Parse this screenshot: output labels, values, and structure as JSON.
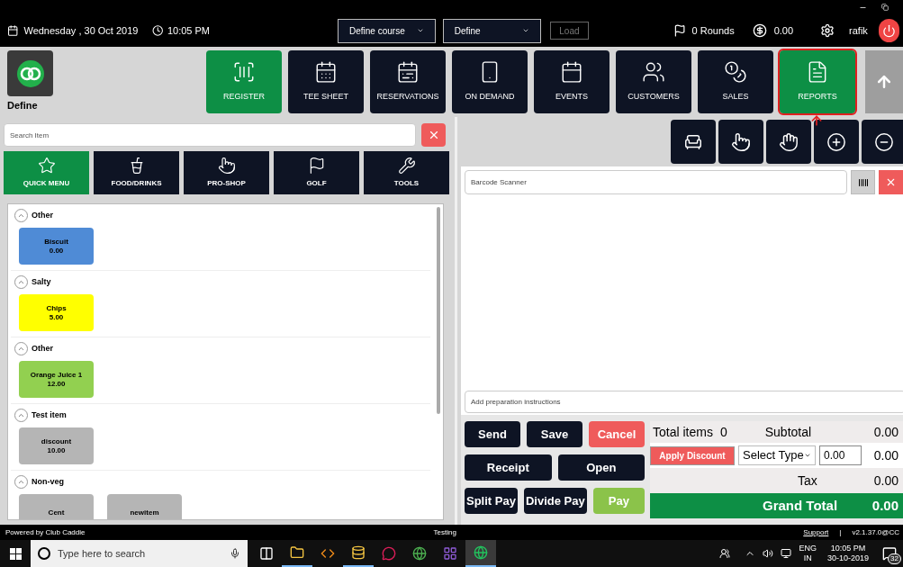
{
  "header": {
    "date": "Wednesday , 30 Oct 2019",
    "time": "10:05 PM",
    "course_select": "Define course",
    "define_select": "Define",
    "load_button": {
      "label": "Load",
      "disabled": true
    },
    "rounds": "0 Rounds",
    "amount": "0.00",
    "user": "rafik"
  },
  "logo_label": "Define",
  "nav": [
    {
      "kind": "register",
      "label": "REGISTER",
      "selected": true,
      "annotated": false
    },
    {
      "kind": "tee_sheet",
      "label": "TEE SHEET",
      "selected": false,
      "annotated": false
    },
    {
      "kind": "reservations",
      "label": "RESERVATIONS",
      "selected": false,
      "annotated": false
    },
    {
      "kind": "on_demand",
      "label": "ON DEMAND",
      "selected": false,
      "annotated": false
    },
    {
      "kind": "events",
      "label": "EVENTS",
      "selected": false,
      "annotated": false
    },
    {
      "kind": "customers",
      "label": "CUSTOMERS",
      "selected": false,
      "annotated": false
    },
    {
      "kind": "sales",
      "label": "SALES",
      "selected": false,
      "annotated": false
    },
    {
      "kind": "reports",
      "label": "REPORTS",
      "selected": true,
      "annotated": true
    }
  ],
  "left": {
    "search": {
      "placeholder": "Search Item"
    },
    "categories": [
      {
        "kind": "quick",
        "label": "QUICK MENU",
        "selected": true
      },
      {
        "kind": "food",
        "label": "FOOD/DRINKS",
        "selected": false
      },
      {
        "kind": "pro",
        "label": "PRO-SHOP",
        "selected": false
      },
      {
        "kind": "golf",
        "label": "GOLF",
        "selected": false
      },
      {
        "kind": "tools",
        "label": "TOOLS",
        "selected": false
      }
    ],
    "sections": [
      {
        "title": "Other",
        "expanded": true,
        "items": [
          {
            "name": "Biscuit",
            "price": "0.00",
            "color": "#4f8bd6"
          }
        ]
      },
      {
        "title": "Salty",
        "expanded": true,
        "items": [
          {
            "name": "Chips",
            "price": "5.00",
            "color": "#ffff00"
          }
        ]
      },
      {
        "title": "Other",
        "expanded": true,
        "items": [
          {
            "name": "Orange Juice 1",
            "price": "12.00",
            "color": "#92d050"
          }
        ]
      },
      {
        "title": "Test item",
        "expanded": true,
        "items": [
          {
            "name": "discount",
            "price": "10.00",
            "color": "#b5b5b5"
          }
        ]
      },
      {
        "title": "Non-veg",
        "expanded": true,
        "items": [
          {
            "name": "Cent",
            "color": "#b5b5b5"
          },
          {
            "name": "newitem",
            "color": "#b5b5b5"
          }
        ]
      }
    ]
  },
  "right": {
    "barcode": {
      "placeholder": "Barcode Scanner"
    },
    "instructions": {
      "placeholder": "Add preparation instructions"
    },
    "actions": [
      [
        {
          "label": "Send",
          "kind": "dark"
        },
        {
          "label": "Save",
          "kind": "dark"
        },
        {
          "label": "Cancel",
          "kind": "danger"
        }
      ],
      [
        {
          "label": "Receipt",
          "kind": "dark"
        },
        {
          "label": "Open",
          "kind": "dark"
        }
      ],
      [
        {
          "label": "Split Pay",
          "kind": "dark"
        },
        {
          "label": "Divide Pay",
          "kind": "dark"
        },
        {
          "label": "Pay",
          "kind": "success"
        }
      ]
    ],
    "totals": {
      "items_label": "Total items",
      "items": "0",
      "subtotal_label": "Subtotal",
      "subtotal": "0.00",
      "discount_button": "Apply Discount",
      "discount_type": "Select Type",
      "discount_value": "0.00",
      "discount_amount": "0.00",
      "tax_label": "Tax",
      "tax": "0.00",
      "grand_total_label": "Grand Total",
      "grand_total": "0.00"
    }
  },
  "status_bar": {
    "left": "Powered by Club Caddie",
    "center": "Testing",
    "support": "Support",
    "separator": "|",
    "version": "v2.1.37.0@CC"
  },
  "taskbar": {
    "search_placeholder": "Type here to search",
    "apps": [
      {
        "kind": "taskview",
        "running": false,
        "active": false
      },
      {
        "kind": "folder",
        "running": true,
        "active": false
      },
      {
        "kind": "editor",
        "running": false,
        "active": false
      },
      {
        "kind": "database",
        "running": true,
        "active": false
      },
      {
        "kind": "chat",
        "running": false,
        "active": false
      },
      {
        "kind": "browser",
        "running": false,
        "active": false
      },
      {
        "kind": "ide",
        "running": false,
        "active": false
      },
      {
        "kind": "caddie",
        "running": true,
        "active": true
      }
    ],
    "lang": "ENG",
    "region": "IN",
    "time": "10:05 PM",
    "date": "30-10-2019",
    "notifications": "32"
  }
}
